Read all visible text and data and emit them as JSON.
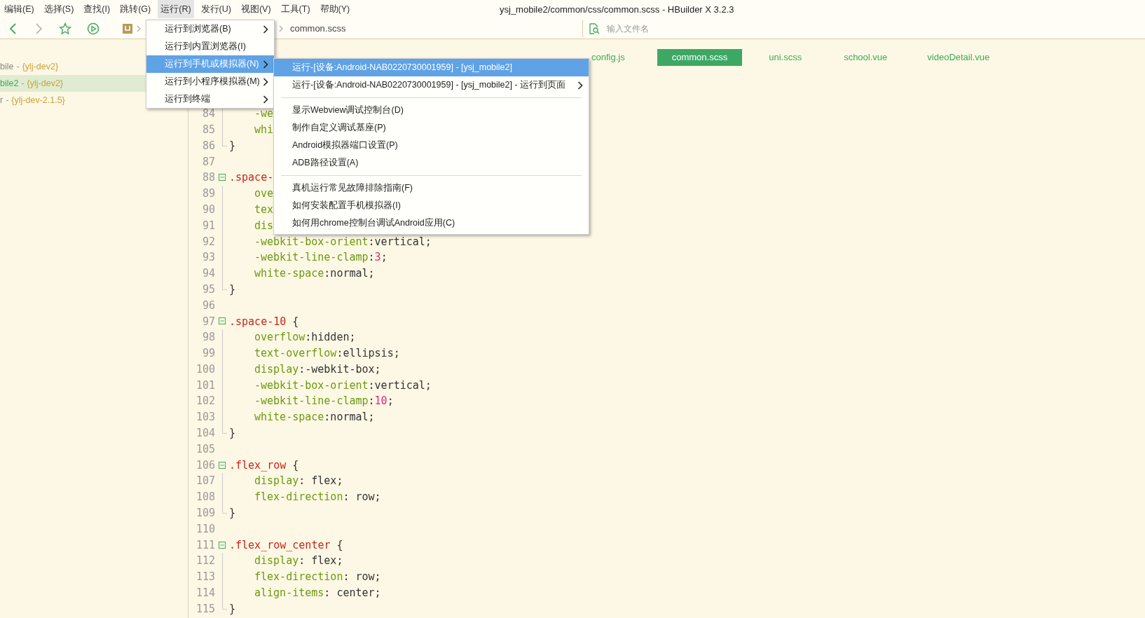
{
  "menu_bar": [
    {
      "label": "编辑(E)",
      "selected": false
    },
    {
      "label": "选择(S)",
      "selected": false
    },
    {
      "label": "查找(I)",
      "selected": false
    },
    {
      "label": "跳转(G)",
      "selected": false
    },
    {
      "label": "运行(R)",
      "selected": true
    },
    {
      "label": "发行(U)",
      "selected": false
    },
    {
      "label": "视图(V)",
      "selected": false
    },
    {
      "label": "工具(T)",
      "selected": false
    },
    {
      "label": "帮助(Y)",
      "selected": false
    }
  ],
  "window_title": "ysj_mobile2/common/css/common.scss - HBuilder X 3.2.3",
  "toolbar": {
    "breadcrumb": "common.scss",
    "file_search": {
      "placeholder": "输入文件名"
    }
  },
  "sidebar": {
    "items": [
      {
        "project": "bile",
        "separator": "-",
        "branch": "{ylj-dev2}",
        "selected": false
      },
      {
        "project": "bile2",
        "separator": "-",
        "branch": "{ylj-dev2}",
        "selected": true
      },
      {
        "project": "r",
        "separator": "-",
        "branch": "{ylj-dev-2.1.5}",
        "selected": false
      }
    ]
  },
  "tabs": [
    {
      "label": "config.js",
      "selected": false
    },
    {
      "label": "common.scss",
      "selected": true
    },
    {
      "label": "uni.scss",
      "selected": false
    },
    {
      "label": "school.vue",
      "selected": false
    },
    {
      "label": "videoDetail.vue",
      "selected": false
    }
  ],
  "editor": {
    "lines": [
      {
        "number": "84",
        "kind": "inside",
        "tokens": [
          {
            "kind": "property",
            "text": "-we"
          }
        ]
      },
      {
        "number": "85",
        "kind": "inside",
        "tokens": [
          {
            "kind": "property",
            "text": "whi"
          }
        ]
      },
      {
        "number": "86",
        "kind": "end",
        "tokens": [
          {
            "kind": "plain",
            "text": "}"
          }
        ]
      },
      {
        "number": "87",
        "kind": "blank"
      },
      {
        "number": "88",
        "kind": "start",
        "tokens": [
          {
            "kind": "selector",
            "text": ".space-"
          }
        ]
      },
      {
        "number": "89",
        "kind": "inside",
        "tokens": [
          {
            "kind": "property",
            "text": "ove"
          }
        ]
      },
      {
        "number": "90",
        "kind": "inside",
        "tokens": [
          {
            "kind": "property",
            "text": "tex"
          }
        ]
      },
      {
        "number": "91",
        "kind": "inside",
        "tokens": [
          {
            "kind": "property",
            "text": "dis"
          }
        ]
      },
      {
        "number": "92",
        "kind": "inside",
        "tokens": [
          {
            "kind": "property",
            "text": "-webkit-box-orient"
          },
          {
            "kind": "plain",
            "text": ":vertical;"
          }
        ]
      },
      {
        "number": "93",
        "kind": "inside",
        "tokens": [
          {
            "kind": "property",
            "text": "-webkit-line-clamp"
          },
          {
            "kind": "plain",
            "text": ":"
          },
          {
            "kind": "number",
            "text": "3"
          },
          {
            "kind": "plain",
            "text": ";"
          }
        ]
      },
      {
        "number": "94",
        "kind": "inside",
        "tokens": [
          {
            "kind": "property",
            "text": "white-space"
          },
          {
            "kind": "plain",
            "text": ":normal;"
          }
        ]
      },
      {
        "number": "95",
        "kind": "end",
        "tokens": [
          {
            "kind": "plain",
            "text": "}"
          }
        ]
      },
      {
        "number": "96",
        "kind": "blank"
      },
      {
        "number": "97",
        "kind": "start",
        "tokens": [
          {
            "kind": "selector",
            "text": ".space-10"
          },
          {
            "kind": "plain",
            "text": " {"
          }
        ]
      },
      {
        "number": "98",
        "kind": "inside",
        "tokens": [
          {
            "kind": "property",
            "text": "overflow"
          },
          {
            "kind": "plain",
            "text": ":hidden;"
          }
        ]
      },
      {
        "number": "99",
        "kind": "inside",
        "tokens": [
          {
            "kind": "property",
            "text": "text-overflow"
          },
          {
            "kind": "plain",
            "text": ":ellipsis;"
          }
        ]
      },
      {
        "number": "100",
        "kind": "inside",
        "tokens": [
          {
            "kind": "property",
            "text": "display"
          },
          {
            "kind": "plain",
            "text": ":-webkit-box;"
          }
        ]
      },
      {
        "number": "101",
        "kind": "inside",
        "tokens": [
          {
            "kind": "property",
            "text": "-webkit-box-orient"
          },
          {
            "kind": "plain",
            "text": ":vertical;"
          }
        ]
      },
      {
        "number": "102",
        "kind": "inside",
        "tokens": [
          {
            "kind": "property",
            "text": "-webkit-line-clamp"
          },
          {
            "kind": "plain",
            "text": ":"
          },
          {
            "kind": "number",
            "text": "10"
          },
          {
            "kind": "plain",
            "text": ";"
          }
        ]
      },
      {
        "number": "103",
        "kind": "inside",
        "tokens": [
          {
            "kind": "property",
            "text": "white-space"
          },
          {
            "kind": "plain",
            "text": ":normal;"
          }
        ]
      },
      {
        "number": "104",
        "kind": "end",
        "tokens": [
          {
            "kind": "plain",
            "text": "}"
          }
        ]
      },
      {
        "number": "105",
        "kind": "blank"
      },
      {
        "number": "106",
        "kind": "start",
        "tokens": [
          {
            "kind": "selector",
            "text": ".flex_row"
          },
          {
            "kind": "plain",
            "text": " {"
          }
        ]
      },
      {
        "number": "107",
        "kind": "inside",
        "tokens": [
          {
            "kind": "property",
            "text": "display"
          },
          {
            "kind": "plain",
            "text": ": flex;"
          }
        ]
      },
      {
        "number": "108",
        "kind": "inside",
        "tokens": [
          {
            "kind": "property",
            "text": "flex-direction"
          },
          {
            "kind": "plain",
            "text": ": row;"
          }
        ]
      },
      {
        "number": "109",
        "kind": "end",
        "tokens": [
          {
            "kind": "plain",
            "text": "}"
          }
        ]
      },
      {
        "number": "110",
        "kind": "blank"
      },
      {
        "number": "111",
        "kind": "start",
        "tokens": [
          {
            "kind": "selector",
            "text": ".flex_row_center"
          },
          {
            "kind": "plain",
            "text": " {"
          }
        ]
      },
      {
        "number": "112",
        "kind": "inside",
        "tokens": [
          {
            "kind": "property",
            "text": "display"
          },
          {
            "kind": "plain",
            "text": ": flex;"
          }
        ]
      },
      {
        "number": "113",
        "kind": "inside",
        "tokens": [
          {
            "kind": "property",
            "text": "flex-direction"
          },
          {
            "kind": "plain",
            "text": ": row;"
          }
        ]
      },
      {
        "number": "114",
        "kind": "inside",
        "tokens": [
          {
            "kind": "property",
            "text": "align-items"
          },
          {
            "kind": "plain",
            "text": ": center;"
          }
        ]
      },
      {
        "number": "115",
        "kind": "end",
        "tokens": [
          {
            "kind": "plain",
            "text": "}"
          }
        ]
      }
    ]
  },
  "run_menu": {
    "items": [
      {
        "label": "运行到浏览器(B)",
        "submenu": true,
        "selected": false
      },
      {
        "label": "运行到内置浏览器(I)",
        "submenu": false,
        "selected": false
      },
      {
        "label": "运行到手机或模拟器(N)",
        "submenu": true,
        "selected": true
      },
      {
        "label": "运行到小程序模拟器(M)",
        "submenu": true,
        "selected": false
      },
      {
        "label": "运行到终端",
        "submenu": true,
        "selected": false
      }
    ]
  },
  "device_submenu": {
    "groups": [
      [
        {
          "label": "运行-[设备:Android-NAB0220730001959] - [ysj_mobile2]",
          "submenu": false,
          "selected": true
        },
        {
          "label": "运行-[设备:Android-NAB0220730001959] - [ysj_mobile2] - 运行到页面",
          "submenu": true,
          "selected": false
        }
      ],
      [
        {
          "label": "显示Webview调试控制台(D)",
          "submenu": false,
          "selected": false
        },
        {
          "label": "制作自定义调试基座(P)",
          "submenu": false,
          "selected": false
        },
        {
          "label": "Android模拟器端口设置(P)",
          "submenu": false,
          "selected": false
        },
        {
          "label": "ADB路径设置(A)",
          "submenu": false,
          "selected": false
        }
      ],
      [
        {
          "label": "真机运行常见故障排除指南(F)",
          "submenu": false,
          "selected": false
        },
        {
          "label": "如何安装配置手机模拟器(I)",
          "submenu": false,
          "selected": false
        },
        {
          "label": "如何用chrome控制台调试Android应用(C)",
          "submenu": false,
          "selected": false
        }
      ]
    ]
  }
}
